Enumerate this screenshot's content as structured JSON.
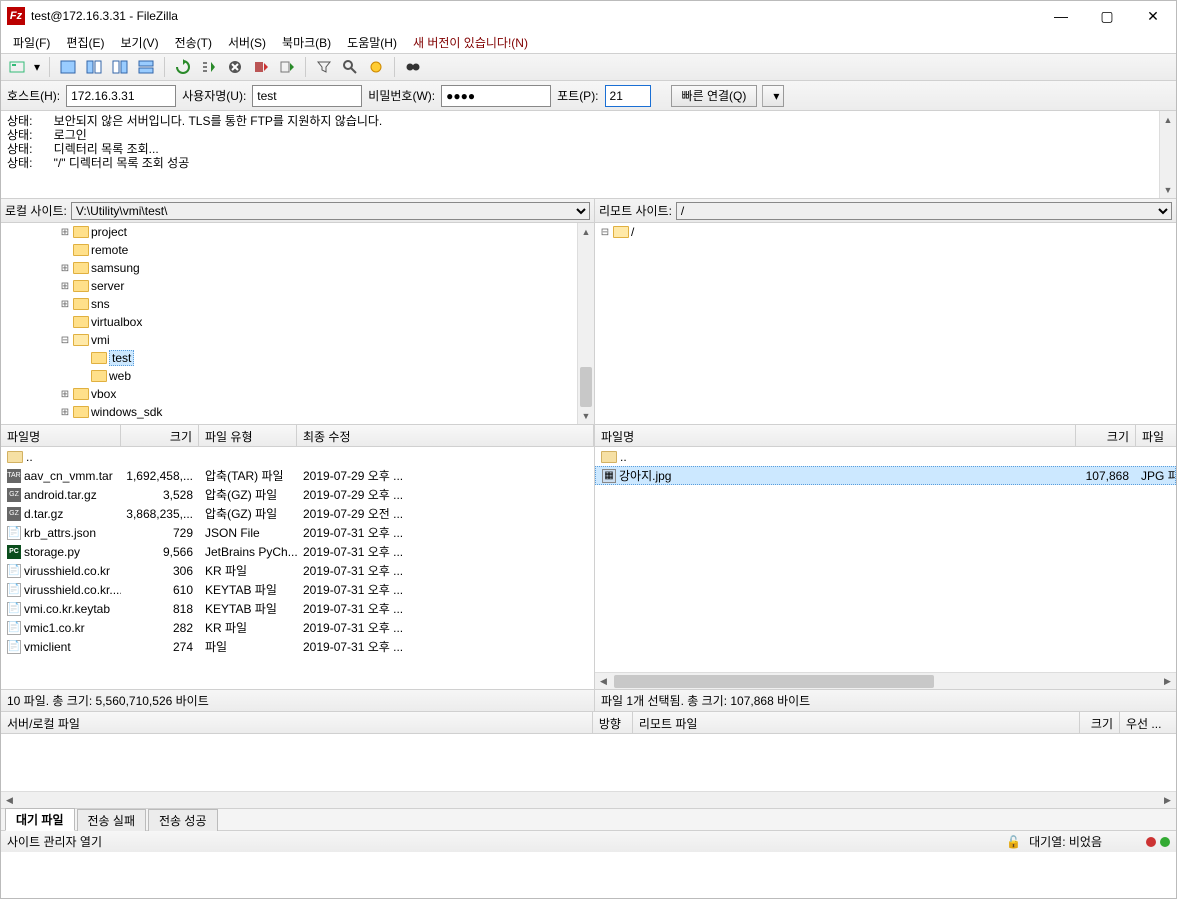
{
  "title": "test@172.16.3.31 - FileZilla",
  "menu": {
    "file": "파일(F)",
    "edit": "편집(E)",
    "view": "보기(V)",
    "transfer": "전송(T)",
    "server": "서버(S)",
    "bookmarks": "북마크(B)",
    "help": "도움말(H)",
    "newver": "새 버전이 있습니다!(N)"
  },
  "quick": {
    "host_l": "호스트(H):",
    "user_l": "사용자명(U):",
    "pass_l": "비밀번호(W):",
    "port_l": "포트(P):",
    "host": "172.16.3.31",
    "user": "test",
    "pass": "●●●●",
    "port": "21",
    "connect": "빠른 연결(Q)"
  },
  "log": [
    {
      "s": "상태:",
      "m": "보안되지 않은 서버입니다. TLS를 통한 FTP를 지원하지 않습니다."
    },
    {
      "s": "상태:",
      "m": "로그인"
    },
    {
      "s": "상태:",
      "m": "디렉터리 목록 조회..."
    },
    {
      "s": "상태:",
      "m": "\"/\" 디렉터리 목록 조회 성공"
    }
  ],
  "local": {
    "site_l": "로컬 사이트:",
    "path": "V:\\Utility\\vmi\\test\\",
    "tree": [
      {
        "ind": 3,
        "exp": "+",
        "name": "project"
      },
      {
        "ind": 3,
        "exp": "",
        "name": "remote"
      },
      {
        "ind": 3,
        "exp": "+",
        "name": "samsung"
      },
      {
        "ind": 3,
        "exp": "+",
        "name": "server"
      },
      {
        "ind": 3,
        "exp": "+",
        "name": "sns"
      },
      {
        "ind": 3,
        "exp": "",
        "name": "virtualbox"
      },
      {
        "ind": 3,
        "exp": "-",
        "name": "vmi",
        "open": true
      },
      {
        "ind": 4,
        "exp": "",
        "name": "test",
        "sel": true
      },
      {
        "ind": 4,
        "exp": "",
        "name": "web"
      },
      {
        "ind": 3,
        "exp": "+",
        "name": "vbox"
      },
      {
        "ind": 3,
        "exp": "+",
        "name": "windows_sdk"
      }
    ],
    "cols": {
      "name": "파일명",
      "size": "크기",
      "type": "파일 유형",
      "mod": "최종 수정"
    },
    "rows": [
      {
        "ico": "up",
        "name": "..",
        "size": "",
        "type": "",
        "mod": ""
      },
      {
        "ico": "tar",
        "name": "aav_cn_vmm.tar",
        "size": "1,692,458,...",
        "type": "압축(TAR) 파일",
        "mod": "2019-07-29 오후 ..."
      },
      {
        "ico": "gz",
        "name": "android.tar.gz",
        "size": "3,528",
        "type": "압축(GZ) 파일",
        "mod": "2019-07-29 오후 ..."
      },
      {
        "ico": "gz",
        "name": "d.tar.gz",
        "size": "3,868,235,...",
        "type": "압축(GZ) 파일",
        "mod": "2019-07-29 오전 ..."
      },
      {
        "ico": "file",
        "name": "krb_attrs.json",
        "size": "729",
        "type": "JSON File",
        "mod": "2019-07-31 오후 ..."
      },
      {
        "ico": "py",
        "name": "storage.py",
        "size": "9,566",
        "type": "JetBrains PyCh...",
        "mod": "2019-07-31 오후 ..."
      },
      {
        "ico": "file",
        "name": "virusshield.co.kr",
        "size": "306",
        "type": "KR 파일",
        "mod": "2019-07-31 오후 ..."
      },
      {
        "ico": "file",
        "name": "virusshield.co.kr....",
        "size": "610",
        "type": "KEYTAB 파일",
        "mod": "2019-07-31 오후 ..."
      },
      {
        "ico": "file",
        "name": "vmi.co.kr.keytab",
        "size": "818",
        "type": "KEYTAB 파일",
        "mod": "2019-07-31 오후 ..."
      },
      {
        "ico": "file",
        "name": "vmic1.co.kr",
        "size": "282",
        "type": "KR 파일",
        "mod": "2019-07-31 오후 ..."
      },
      {
        "ico": "file",
        "name": "vmiclient",
        "size": "274",
        "type": "파일",
        "mod": "2019-07-31 오후 ..."
      }
    ],
    "status": "10 파일. 총 크기: 5,560,710,526 바이트"
  },
  "remote": {
    "site_l": "리모트 사이트:",
    "path": "/",
    "tree": [
      {
        "ind": 0,
        "exp": "-",
        "name": "/",
        "open": true
      }
    ],
    "cols": {
      "name": "파일명",
      "size": "크기",
      "type": "파일"
    },
    "rows": [
      {
        "ico": "up",
        "name": "..",
        "size": "",
        "type": ""
      },
      {
        "ico": "img",
        "name": "강아지.jpg",
        "size": "107,868",
        "type": "JPG 피",
        "sel": true
      }
    ],
    "status": "파일 1개 선택됨. 총 크기: 107,868 바이트"
  },
  "xfer": {
    "cols": {
      "srv": "서버/로컬 파일",
      "dir": "방향",
      "rmt": "리모트 파일",
      "sz": "크기",
      "pri": "우선 ..."
    },
    "tabs": {
      "queue": "대기 파일",
      "failed": "전송 실패",
      "success": "전송 성공"
    }
  },
  "footer": {
    "hint": "사이트 관리자 열기",
    "queue": "대기열: 비었음"
  }
}
